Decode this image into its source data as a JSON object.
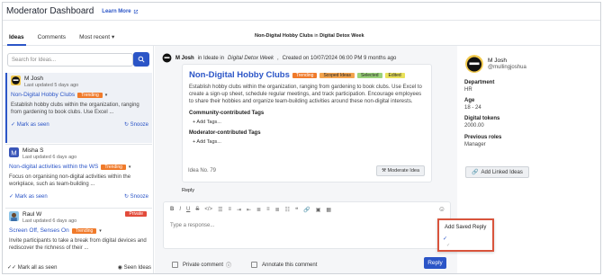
{
  "app": {
    "title": "Moderator Dashboard",
    "learn_more": "Learn More"
  },
  "tabs": [
    {
      "label": "Ideas"
    },
    {
      "label": "Comments"
    }
  ],
  "sort": {
    "label": "Most recent"
  },
  "breadcrumb": {
    "idea": "Non-Digital Hobby Clubs",
    "sep": "in",
    "group": "Digital Detox Week"
  },
  "search": {
    "placeholder": "Search for Ideas..."
  },
  "ideas": [
    {
      "author": "M Josh",
      "updated": "Last updated 5 days ago",
      "title": "Non-Digital Hobby Clubs",
      "badge": "Trending",
      "desc": "Establish hobby clubs within the organization, ranging from gardening to book clubs. Use Excel ...",
      "action1": "Mark as seen",
      "action2": "Snooze"
    },
    {
      "author": "Misha S",
      "updated": "Last updated 6 days ago",
      "title": "Non-digital activities within the WS",
      "badge": "Trending",
      "desc": "Focus on organising non-digital activities within the workplace, such as team-building ...",
      "action1": "Mark as seen",
      "action2": "Snooze"
    },
    {
      "author": "Raul W",
      "updated": "Last updated 6 days ago",
      "title": "Screen Off, Senses On",
      "badge": "Trending",
      "private": "Private",
      "desc": "Invite participants to take a break from digital devices and rediscover the richness of their ..."
    }
  ],
  "list_footer": {
    "mark_all": "Mark all as seen",
    "seen": "Seen Ideas"
  },
  "post": {
    "author": "M Josh",
    "in": "in Ideate in",
    "group": "Digital Detox Week",
    "created": "Created on 10/07/2024 06:00 PM 9 months ago",
    "title": "Non-Digital Hobby Clubs",
    "badges": [
      "Trending",
      "Scoped Ideas",
      "Selected",
      "Edited"
    ],
    "desc": "Establish hobby clubs within the organization, ranging from gardening to book clubs. Use Excel to create a sign-up sheet, schedule regular meetings, and track participation. Encourage employees to share their hobbies and organize team-building activities around these non-digital interests.",
    "community_tags": "Community-contributed Tags",
    "moderator_tags": "Moderator-contributed Tags",
    "add_tags": "+ Add Tags...",
    "idea_no": "Idea No. 79",
    "moderate": "Moderate Idea",
    "reply_label": "Reply"
  },
  "editor": {
    "placeholder": "Type a response...",
    "private": "Private comment",
    "annotate": "Annotate this comment",
    "reply": "Reply"
  },
  "saved_reply": {
    "label": "Add Saved Reply"
  },
  "profile": {
    "name": "M Josh",
    "handle": "@mullingjoshua",
    "department_k": "Department",
    "department_v": "HR",
    "age_k": "Age",
    "age_v": "18 - 24",
    "tokens_k": "Digital tokens",
    "tokens_v": "2000.00",
    "roles_k": "Previous roles",
    "roles_v": "Manager",
    "linked": "Add Linked Ideas"
  },
  "colors": {
    "accent": "#2b55c7",
    "trending": "#f07a2a",
    "private": "#e24b3b",
    "highlight": "#d9543c"
  }
}
